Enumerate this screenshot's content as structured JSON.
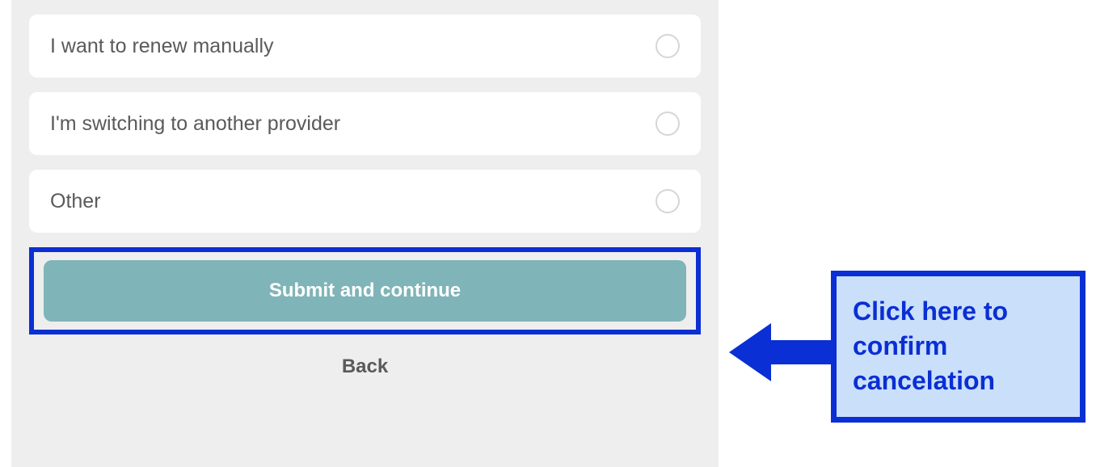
{
  "options": [
    {
      "label": "I want to renew manually"
    },
    {
      "label": "I'm switching to another provider"
    },
    {
      "label": "Other"
    }
  ],
  "buttons": {
    "submit": "Submit and continue",
    "back": "Back"
  },
  "callout": {
    "text": "Click here to confirm cancelation"
  }
}
